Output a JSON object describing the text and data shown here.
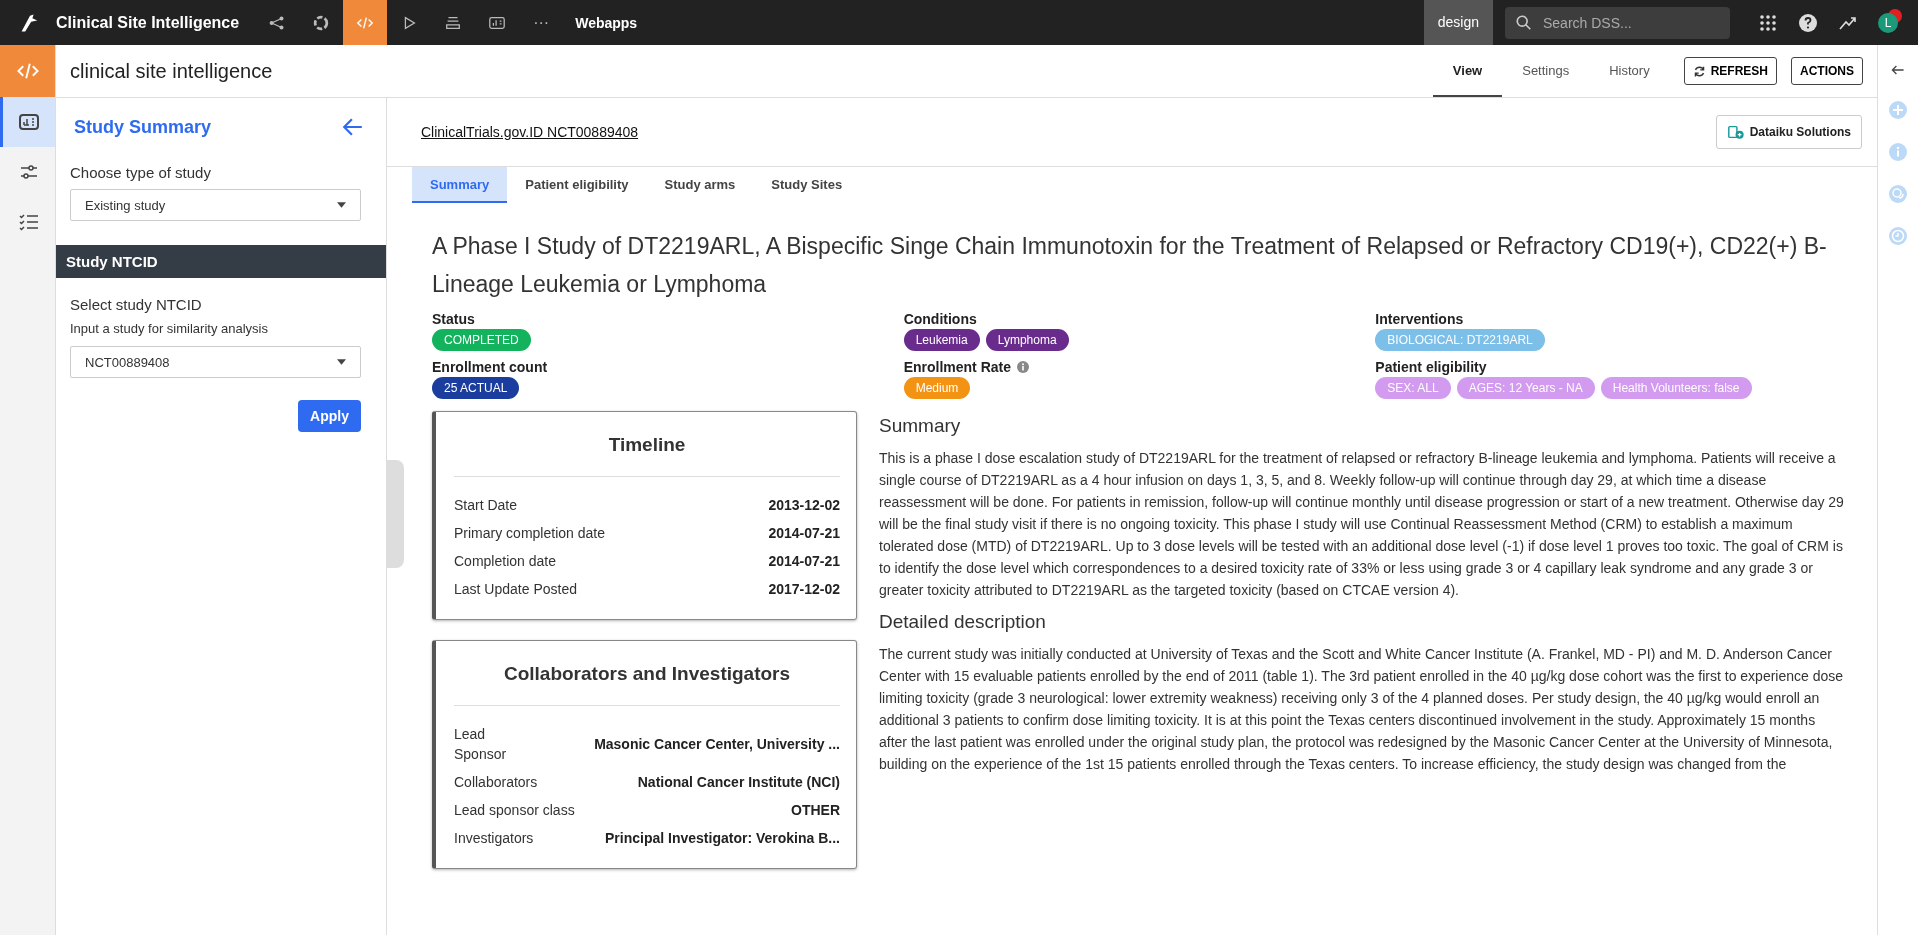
{
  "topbar": {
    "project": "Clinical Site Intelligence",
    "nav_icons": [
      {
        "kind": "flow",
        "selected": false
      },
      {
        "kind": "ring",
        "selected": false
      },
      {
        "kind": "code",
        "selected": true
      },
      {
        "kind": "play",
        "selected": false
      },
      {
        "kind": "stack",
        "selected": false
      },
      {
        "kind": "dashboard",
        "selected": false
      }
    ],
    "more": "···",
    "section": "Webapps",
    "mode": "design",
    "search": {
      "placeholder": "Search DSS..."
    },
    "avatar": "L"
  },
  "header": {
    "title": "clinical site intelligence",
    "tabs": [
      {
        "label": "View",
        "selected": true
      },
      {
        "label": "Settings",
        "selected": false
      },
      {
        "label": "History",
        "selected": false
      }
    ],
    "refresh": "REFRESH",
    "actions": "ACTIONS"
  },
  "sidebar": {
    "rail": [
      {
        "kind": "dashboard",
        "selected": true
      },
      {
        "kind": "sliders",
        "selected": false
      },
      {
        "kind": "checklist",
        "selected": false
      }
    ],
    "title": "Study Summary",
    "type_label": "Choose type of study",
    "type_value": "Existing study",
    "section": "Study NTCID",
    "id_label": "Select study NTCID",
    "id_hint": "Input a study for similarity analysis",
    "id_value": "NCT00889408",
    "apply": "Apply"
  },
  "page": {
    "link": "ClinicalTrials.gov.ID NCT00889408",
    "solutions_button": "Dataiku Solutions",
    "tabs": [
      {
        "label": "Summary",
        "selected": true
      },
      {
        "label": "Patient eligibility",
        "selected": false
      },
      {
        "label": "Study arms",
        "selected": false
      },
      {
        "label": "Study Sites",
        "selected": false
      }
    ],
    "title": "A Phase I Study of DT2219ARL, A Bispecific Singe Chain Immunotoxin for the Treatment of Relapsed or Refractory CD19(+), CD22(+) B-Lineage Leukemia or Lymphoma",
    "fields": [
      {
        "label": "Status",
        "info": false,
        "tags": [
          {
            "text": "COMPLETED",
            "color": "#12b35c"
          }
        ]
      },
      {
        "label": "Conditions",
        "info": false,
        "tags": [
          {
            "text": "Leukemia",
            "color": "#6a2c8c"
          },
          {
            "text": "Lymphoma",
            "color": "#6a2c8c"
          }
        ]
      },
      {
        "label": "Interventions",
        "info": false,
        "tags": [
          {
            "text": "BIOLOGICAL: DT2219ARL",
            "color": "#7cbfe8"
          }
        ]
      },
      {
        "label": "Enrollment count",
        "info": false,
        "tags": [
          {
            "text": "25 ACTUAL",
            "color": "#1a3d9e"
          }
        ]
      },
      {
        "label": "Enrollment Rate",
        "info": true,
        "tags": [
          {
            "text": "Medium",
            "color": "#f39313"
          }
        ]
      },
      {
        "label": "Patient eligibility",
        "info": false,
        "tags": [
          {
            "text": "SEX: ALL",
            "color": "#d29bef"
          },
          {
            "text": "AGES: 12 Years - NA",
            "color": "#d29bef"
          },
          {
            "text": "Health Volunteers: false",
            "color": "#d29bef"
          }
        ]
      }
    ],
    "cards": [
      {
        "title": "Timeline",
        "rows": [
          {
            "label": "Start Date",
            "value": "2013-12-02"
          },
          {
            "label": "Primary completion date",
            "value": "2014-07-21"
          },
          {
            "label": "Completion date",
            "value": "2014-07-21"
          },
          {
            "label": "Last Update Posted",
            "value": "2017-12-02"
          }
        ]
      },
      {
        "title": "Collaborators and Investigators",
        "rows": [
          {
            "label": "Lead Sponsor",
            "value": "Masonic Cancer Center, University ..."
          },
          {
            "label": "Collaborators",
            "value": "National Cancer Institute (NCI)"
          },
          {
            "label": "Lead sponsor class",
            "value": "OTHER"
          },
          {
            "label": "Investigators",
            "value": "Principal Investigator: Verokina B..."
          }
        ]
      }
    ],
    "sections": [
      {
        "heading": "Summary",
        "text": "This is a phase I dose escalation study of DT2219ARL for the treatment of relapsed or refractory B-lineage leukemia and lymphoma. Patients will receive a single course of DT2219ARL as a 4 hour infusion on days 1, 3, 5, and 8. Weekly follow-up will continue through day 29, at which time a disease reassessment will be done. For patients in remission, follow-up will continue monthly until disease progression or start of a new treatment. Otherwise day 29 will be the final study visit if there is no ongoing toxicity. This phase I study will use Continual Reassessment Method (CRM) to establish a maximum tolerated dose (MTD) of DT2219ARL. Up to 3 dose levels will be tested with an additional dose level (-1) if dose level 1 proves too toxic. The goal of CRM is to identify the dose level which correspondences to a desired toxicity rate of 33% or less using grade 3 or 4 capillary leak syndrome and any grade 3 or greater toxicity attributed to DT2219ARL as the targeted toxicity (based on CTCAE version 4)."
      },
      {
        "heading": "Detailed description",
        "text": "The current study was initially conducted at University of Texas and the Scott and White Cancer Institute (A. Frankel, MD - PI) and M. D. Anderson Cancer Center with 15 evaluable patients enrolled by the end of 2011 (table 1). The 3rd patient enrolled in the 40 µg/kg dose cohort was the first to experience dose limiting toxicity (grade 3 neurological: lower extremity weakness) receiving only 3 of the 4 planned doses. Per study design, the 40 µg/kg would enroll an additional 3 patients to confirm dose limiting toxicity. It is at this point the Texas centers discontinued involvement in the study. Approximately 15 months after the last patient was enrolled under the original study plan, the protocol was redesigned by the Masonic Cancer Center at the University of Minnesota, building on the experience of the 1st 15 patients enrolled through the Texas centers. To increase efficiency, the study design was changed from the"
      }
    ]
  },
  "right_rail": [
    {
      "kind": "plus"
    },
    {
      "kind": "info"
    },
    {
      "kind": "chat"
    },
    {
      "kind": "clock"
    }
  ]
}
